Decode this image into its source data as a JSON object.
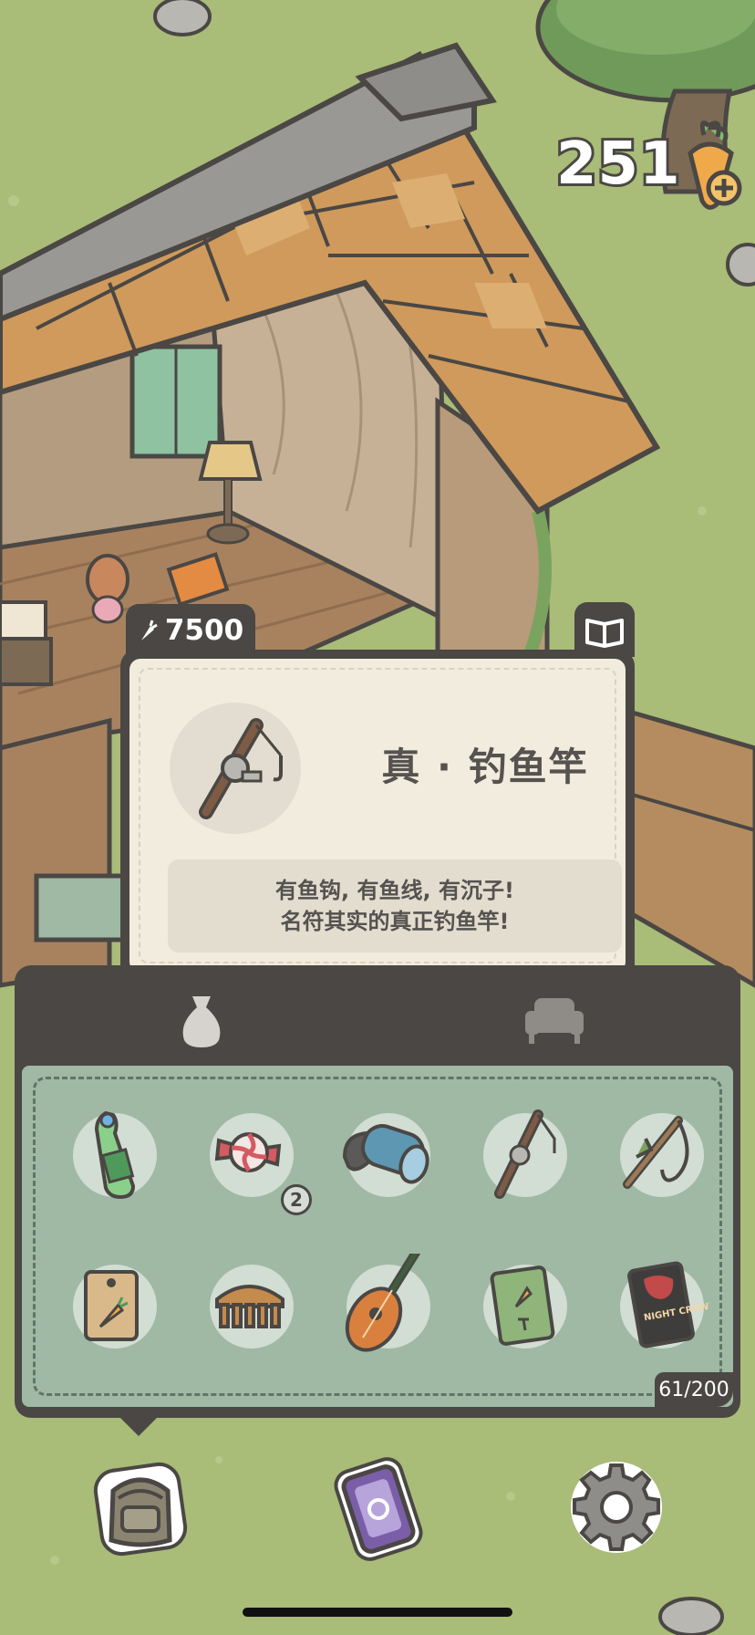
{
  "hud": {
    "carrot_count": "251",
    "carrot_icon": "carrot-plus-icon"
  },
  "item_card": {
    "price": "7500",
    "price_icon": "carrot-icon",
    "book_icon": "book-icon",
    "title": "真 · 钓鱼竿",
    "description_line1": "有鱼钩, 有鱼线, 有沉子!",
    "description_line2": "名符其实的真正钓鱼竿!",
    "item_icon": "fishing-rod-icon"
  },
  "inventory": {
    "tabs": [
      {
        "name": "bag-tab",
        "icon": "sack-icon"
      },
      {
        "name": "furniture-tab",
        "icon": "armchair-icon"
      }
    ],
    "items": [
      {
        "icon": "ramune-bottle-icon",
        "quantity": ""
      },
      {
        "icon": "candy-icon",
        "quantity": "2"
      },
      {
        "icon": "sleeping-mat-icon",
        "quantity": ""
      },
      {
        "icon": "fishing-rod-icon",
        "quantity": ""
      },
      {
        "icon": "slingshot-hook-icon",
        "quantity": ""
      },
      {
        "icon": "carrot-seed-packet-icon",
        "quantity": ""
      },
      {
        "icon": "comb-icon",
        "quantity": ""
      },
      {
        "icon": "mandolin-icon",
        "quantity": ""
      },
      {
        "icon": "carrot-book-icon",
        "quantity": ""
      },
      {
        "icon": "night-crawlers-bag-icon",
        "quantity": ""
      }
    ],
    "capacity": "61/200",
    "night_crawlers_label": "NIGHT CRAWLERS"
  },
  "bottom_bar": [
    {
      "name": "backpack-button",
      "icon": "backpack-icon"
    },
    {
      "name": "phone-button",
      "icon": "phone-icon"
    },
    {
      "name": "settings-button",
      "icon": "gear-icon"
    }
  ],
  "colors": {
    "grass": "#a9bc78",
    "panel_dark": "#4a4744",
    "card_bg": "#f1ecdd",
    "inventory_bg": "#9fb9a4"
  }
}
